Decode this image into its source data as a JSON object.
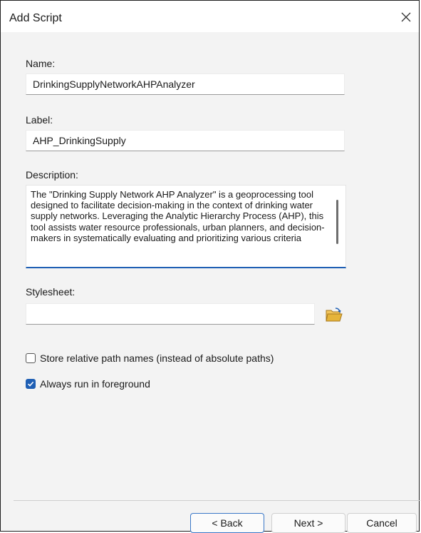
{
  "window": {
    "title": "Add Script"
  },
  "name": {
    "label": "Name:",
    "value": "DrinkingSupplyNetworkAHPAnalyzer"
  },
  "label_field": {
    "label": "Label:",
    "value": "AHP_DrinkingSupply"
  },
  "description": {
    "label": "Description:",
    "value": "The \"Drinking Supply Network AHP Analyzer\" is a geoprocessing tool designed to facilitate decision-making in the context of drinking water supply networks. Leveraging the Analytic Hierarchy Process (AHP), this tool assists water resource professionals, urban planners, and decision-makers in systematically evaluating and prioritizing various criteria"
  },
  "stylesheet": {
    "label": "Stylesheet:",
    "value": ""
  },
  "options": {
    "relative_paths": {
      "label": "Store relative path names (instead of absolute paths)",
      "checked": false
    },
    "foreground": {
      "label": "Always run in foreground",
      "checked": true
    }
  },
  "buttons": {
    "back": "< Back",
    "next": "Next >",
    "cancel": "Cancel"
  },
  "colors": {
    "accent": "#1f5fb4",
    "folder": "#e6b43a"
  }
}
